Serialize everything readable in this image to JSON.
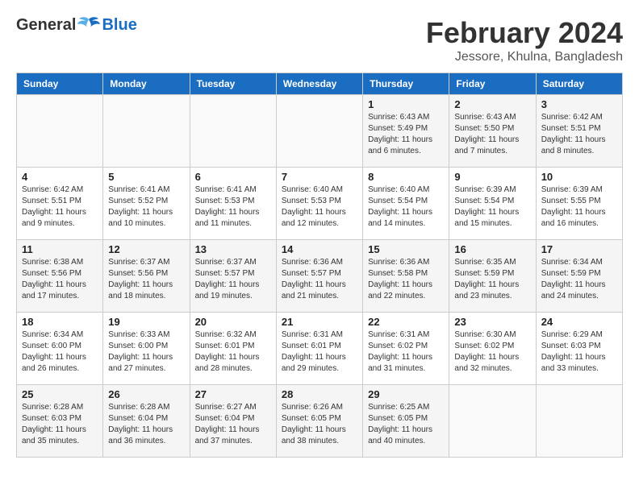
{
  "logo": {
    "general": "General",
    "blue": "Blue"
  },
  "title": {
    "month_year": "February 2024",
    "location": "Jessore, Khulna, Bangladesh"
  },
  "weekdays": [
    "Sunday",
    "Monday",
    "Tuesday",
    "Wednesday",
    "Thursday",
    "Friday",
    "Saturday"
  ],
  "weeks": [
    [
      {
        "day": "",
        "info": ""
      },
      {
        "day": "",
        "info": ""
      },
      {
        "day": "",
        "info": ""
      },
      {
        "day": "",
        "info": ""
      },
      {
        "day": "1",
        "info": "Sunrise: 6:43 AM\nSunset: 5:49 PM\nDaylight: 11 hours and 6 minutes."
      },
      {
        "day": "2",
        "info": "Sunrise: 6:43 AM\nSunset: 5:50 PM\nDaylight: 11 hours and 7 minutes."
      },
      {
        "day": "3",
        "info": "Sunrise: 6:42 AM\nSunset: 5:51 PM\nDaylight: 11 hours and 8 minutes."
      }
    ],
    [
      {
        "day": "4",
        "info": "Sunrise: 6:42 AM\nSunset: 5:51 PM\nDaylight: 11 hours and 9 minutes."
      },
      {
        "day": "5",
        "info": "Sunrise: 6:41 AM\nSunset: 5:52 PM\nDaylight: 11 hours and 10 minutes."
      },
      {
        "day": "6",
        "info": "Sunrise: 6:41 AM\nSunset: 5:53 PM\nDaylight: 11 hours and 11 minutes."
      },
      {
        "day": "7",
        "info": "Sunrise: 6:40 AM\nSunset: 5:53 PM\nDaylight: 11 hours and 12 minutes."
      },
      {
        "day": "8",
        "info": "Sunrise: 6:40 AM\nSunset: 5:54 PM\nDaylight: 11 hours and 14 minutes."
      },
      {
        "day": "9",
        "info": "Sunrise: 6:39 AM\nSunset: 5:54 PM\nDaylight: 11 hours and 15 minutes."
      },
      {
        "day": "10",
        "info": "Sunrise: 6:39 AM\nSunset: 5:55 PM\nDaylight: 11 hours and 16 minutes."
      }
    ],
    [
      {
        "day": "11",
        "info": "Sunrise: 6:38 AM\nSunset: 5:56 PM\nDaylight: 11 hours and 17 minutes."
      },
      {
        "day": "12",
        "info": "Sunrise: 6:37 AM\nSunset: 5:56 PM\nDaylight: 11 hours and 18 minutes."
      },
      {
        "day": "13",
        "info": "Sunrise: 6:37 AM\nSunset: 5:57 PM\nDaylight: 11 hours and 19 minutes."
      },
      {
        "day": "14",
        "info": "Sunrise: 6:36 AM\nSunset: 5:57 PM\nDaylight: 11 hours and 21 minutes."
      },
      {
        "day": "15",
        "info": "Sunrise: 6:36 AM\nSunset: 5:58 PM\nDaylight: 11 hours and 22 minutes."
      },
      {
        "day": "16",
        "info": "Sunrise: 6:35 AM\nSunset: 5:59 PM\nDaylight: 11 hours and 23 minutes."
      },
      {
        "day": "17",
        "info": "Sunrise: 6:34 AM\nSunset: 5:59 PM\nDaylight: 11 hours and 24 minutes."
      }
    ],
    [
      {
        "day": "18",
        "info": "Sunrise: 6:34 AM\nSunset: 6:00 PM\nDaylight: 11 hours and 26 minutes."
      },
      {
        "day": "19",
        "info": "Sunrise: 6:33 AM\nSunset: 6:00 PM\nDaylight: 11 hours and 27 minutes."
      },
      {
        "day": "20",
        "info": "Sunrise: 6:32 AM\nSunset: 6:01 PM\nDaylight: 11 hours and 28 minutes."
      },
      {
        "day": "21",
        "info": "Sunrise: 6:31 AM\nSunset: 6:01 PM\nDaylight: 11 hours and 29 minutes."
      },
      {
        "day": "22",
        "info": "Sunrise: 6:31 AM\nSunset: 6:02 PM\nDaylight: 11 hours and 31 minutes."
      },
      {
        "day": "23",
        "info": "Sunrise: 6:30 AM\nSunset: 6:02 PM\nDaylight: 11 hours and 32 minutes."
      },
      {
        "day": "24",
        "info": "Sunrise: 6:29 AM\nSunset: 6:03 PM\nDaylight: 11 hours and 33 minutes."
      }
    ],
    [
      {
        "day": "25",
        "info": "Sunrise: 6:28 AM\nSunset: 6:03 PM\nDaylight: 11 hours and 35 minutes."
      },
      {
        "day": "26",
        "info": "Sunrise: 6:28 AM\nSunset: 6:04 PM\nDaylight: 11 hours and 36 minutes."
      },
      {
        "day": "27",
        "info": "Sunrise: 6:27 AM\nSunset: 6:04 PM\nDaylight: 11 hours and 37 minutes."
      },
      {
        "day": "28",
        "info": "Sunrise: 6:26 AM\nSunset: 6:05 PM\nDaylight: 11 hours and 38 minutes."
      },
      {
        "day": "29",
        "info": "Sunrise: 6:25 AM\nSunset: 6:05 PM\nDaylight: 11 hours and 40 minutes."
      },
      {
        "day": "",
        "info": ""
      },
      {
        "day": "",
        "info": ""
      }
    ]
  ]
}
